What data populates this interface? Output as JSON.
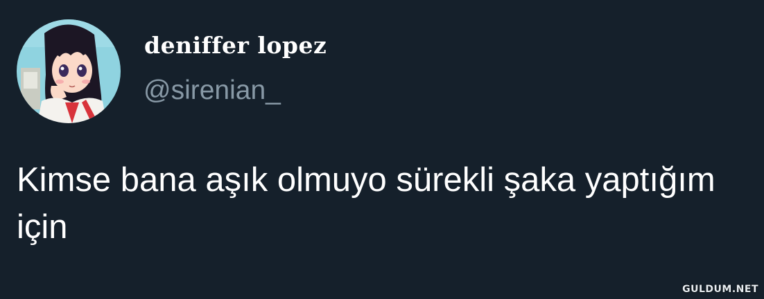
{
  "author": {
    "display_name": "deniffer lopez",
    "handle": "@sirenian_"
  },
  "tweet": {
    "text": "Kimse bana aşık olmuyo sürekli şaka yaptığım için"
  },
  "watermark": "GULDUM.NET",
  "colors": {
    "background": "#15202b",
    "text": "#ffffff",
    "secondary_text": "#8899a6"
  }
}
